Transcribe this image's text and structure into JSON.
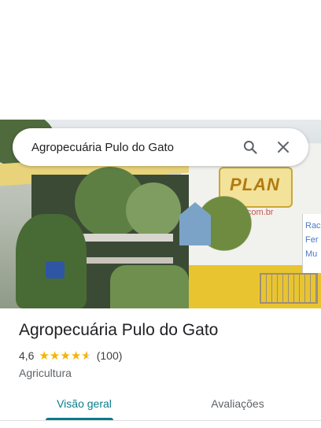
{
  "search": {
    "query": "Agropecuária Pulo do Gato",
    "search_icon": "search-icon",
    "close_icon": "close-icon"
  },
  "photo": {
    "sign_text": "PLAN",
    "wall_text": "plan.com.br",
    "side_text": [
      "Rac",
      "Fer",
      "Mu"
    ]
  },
  "place": {
    "title": "Agropecuária Pulo do Gato",
    "rating": "4,6",
    "rating_value": 4.6,
    "review_count": "(100)",
    "category": "Agricultura"
  },
  "tabs": [
    {
      "label": "Visão geral",
      "selected": true
    },
    {
      "label": "Avaliações",
      "selected": false
    }
  ],
  "colors": {
    "accent": "#0b7b8b",
    "star": "#f4b400",
    "text": "#202124",
    "secondary_text": "#5f6368"
  }
}
